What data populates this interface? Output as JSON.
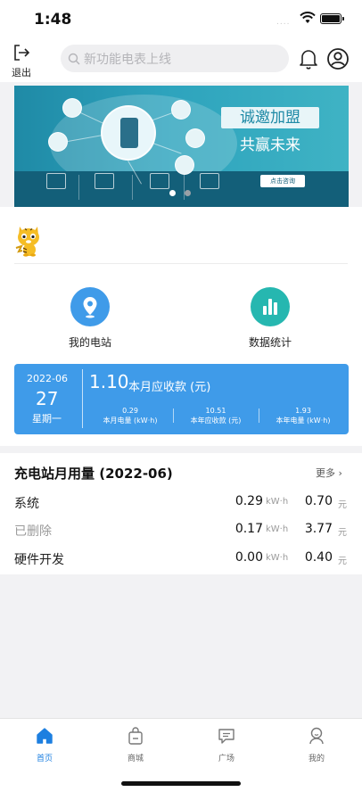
{
  "status_bar": {
    "time": "1:48"
  },
  "header": {
    "logout_label": "退出",
    "search_placeholder": "新功能电表上线",
    "icons": [
      "logout-icon",
      "search-icon",
      "bell-icon",
      "user-circle-icon"
    ]
  },
  "banner": {
    "slogan_line1": "诚邀加盟",
    "slogan_line2": "共赢未来",
    "consult_button": "点击咨询",
    "active_dot": 0
  },
  "quick_actions": [
    {
      "label": "我的电站",
      "icon": "location-pin-icon",
      "color": "#3f9be9"
    },
    {
      "label": "数据统计",
      "icon": "bar-chart-icon",
      "color": "#26b7b0"
    }
  ],
  "stats_card": {
    "year_month": "2022-06",
    "day": "27",
    "weekday": "星期一",
    "month_receivable_value": "1.10",
    "month_receivable_label": "本月应收款 (元)",
    "metrics": [
      {
        "value": "0.29",
        "label": "本月电量 (kW·h)"
      },
      {
        "value": "10.51",
        "label": "本年应收款 (元)"
      },
      {
        "value": "1.93",
        "label": "本年电量 (kW·h)"
      }
    ],
    "color": "#3f9be9"
  },
  "monthly_usage": {
    "title": "充电站月用量 (2022-06)",
    "more_label": "更多",
    "kwh_unit": "kW·h",
    "yuan_unit": "元",
    "rows": [
      {
        "name": "系统",
        "kwh": "0.29",
        "yuan": "0.70",
        "name_color": "#222222"
      },
      {
        "name": "已删除",
        "kwh": "0.17",
        "yuan": "3.77",
        "name_color": "#9a9a9a"
      },
      {
        "name": "硬件开发",
        "kwh": "0.00",
        "yuan": "0.40",
        "name_color": "#222222"
      }
    ]
  },
  "tab_bar": {
    "tabs": [
      {
        "label": "首页",
        "icon": "home-icon",
        "active": true
      },
      {
        "label": "商城",
        "icon": "shopping-bag-icon",
        "active": false
      },
      {
        "label": "广场",
        "icon": "message-icon",
        "active": false
      },
      {
        "label": "我的",
        "icon": "profile-icon",
        "active": false
      }
    ],
    "active_color": "#1d7fe0"
  }
}
